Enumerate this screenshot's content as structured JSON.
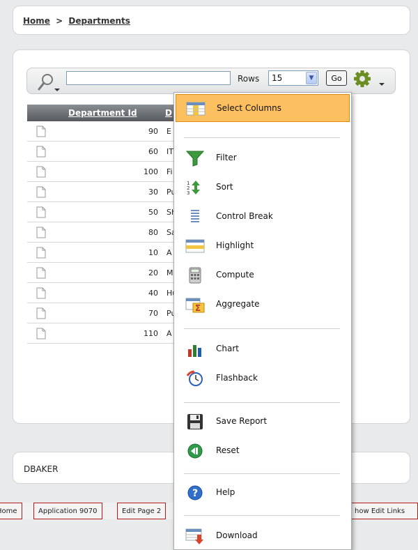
{
  "breadcrumb": {
    "home": "Home",
    "separator": ">",
    "current": "Departments"
  },
  "search": {
    "placeholder": "",
    "value": ""
  },
  "rows": {
    "label": "Rows",
    "value": "15"
  },
  "go_label": "Go",
  "report": {
    "columns": [
      "Department Id",
      "D"
    ],
    "rows": [
      {
        "id": "90",
        "name": "E"
      },
      {
        "id": "60",
        "name": "IT"
      },
      {
        "id": "100",
        "name": "Fi"
      },
      {
        "id": "30",
        "name": "Pu"
      },
      {
        "id": "50",
        "name": "Sh"
      },
      {
        "id": "80",
        "name": "Sa"
      },
      {
        "id": "10",
        "name": "A"
      },
      {
        "id": "20",
        "name": "Ma"
      },
      {
        "id": "40",
        "name": "Hu"
      },
      {
        "id": "70",
        "name": "Pu"
      },
      {
        "id": "110",
        "name": "A"
      }
    ]
  },
  "user": {
    "name": "DBAKER"
  },
  "devbar": {
    "home": "Home",
    "application": "Application 9070",
    "edit_page": "Edit Page 2",
    "show_edit_links": "how Edit Links"
  },
  "actions_menu": {
    "items": [
      {
        "label": "Select Columns",
        "icon": "select-columns-icon",
        "selected": true
      },
      {
        "label": "Filter",
        "icon": "filter-icon"
      },
      {
        "label": "Sort",
        "icon": "sort-icon"
      },
      {
        "label": "Control Break",
        "icon": "control-break-icon"
      },
      {
        "label": "Highlight",
        "icon": "highlight-icon"
      },
      {
        "label": "Compute",
        "icon": "calculator-icon"
      },
      {
        "label": "Aggregate",
        "icon": "aggregate-sigma-icon"
      },
      {
        "label": "Chart",
        "icon": "bar-chart-icon"
      },
      {
        "label": "Flashback",
        "icon": "flashback-clock-icon"
      },
      {
        "label": "Save Report",
        "icon": "floppy-disk-icon"
      },
      {
        "label": "Reset",
        "icon": "reset-icon"
      },
      {
        "label": "Help",
        "icon": "help-icon"
      },
      {
        "label": "Download",
        "icon": "download-icon"
      }
    ]
  },
  "colors": {
    "selected_item_bg": "#fdc061",
    "header_bg": "#6e7175",
    "devbar_border": "#b31b1b"
  }
}
